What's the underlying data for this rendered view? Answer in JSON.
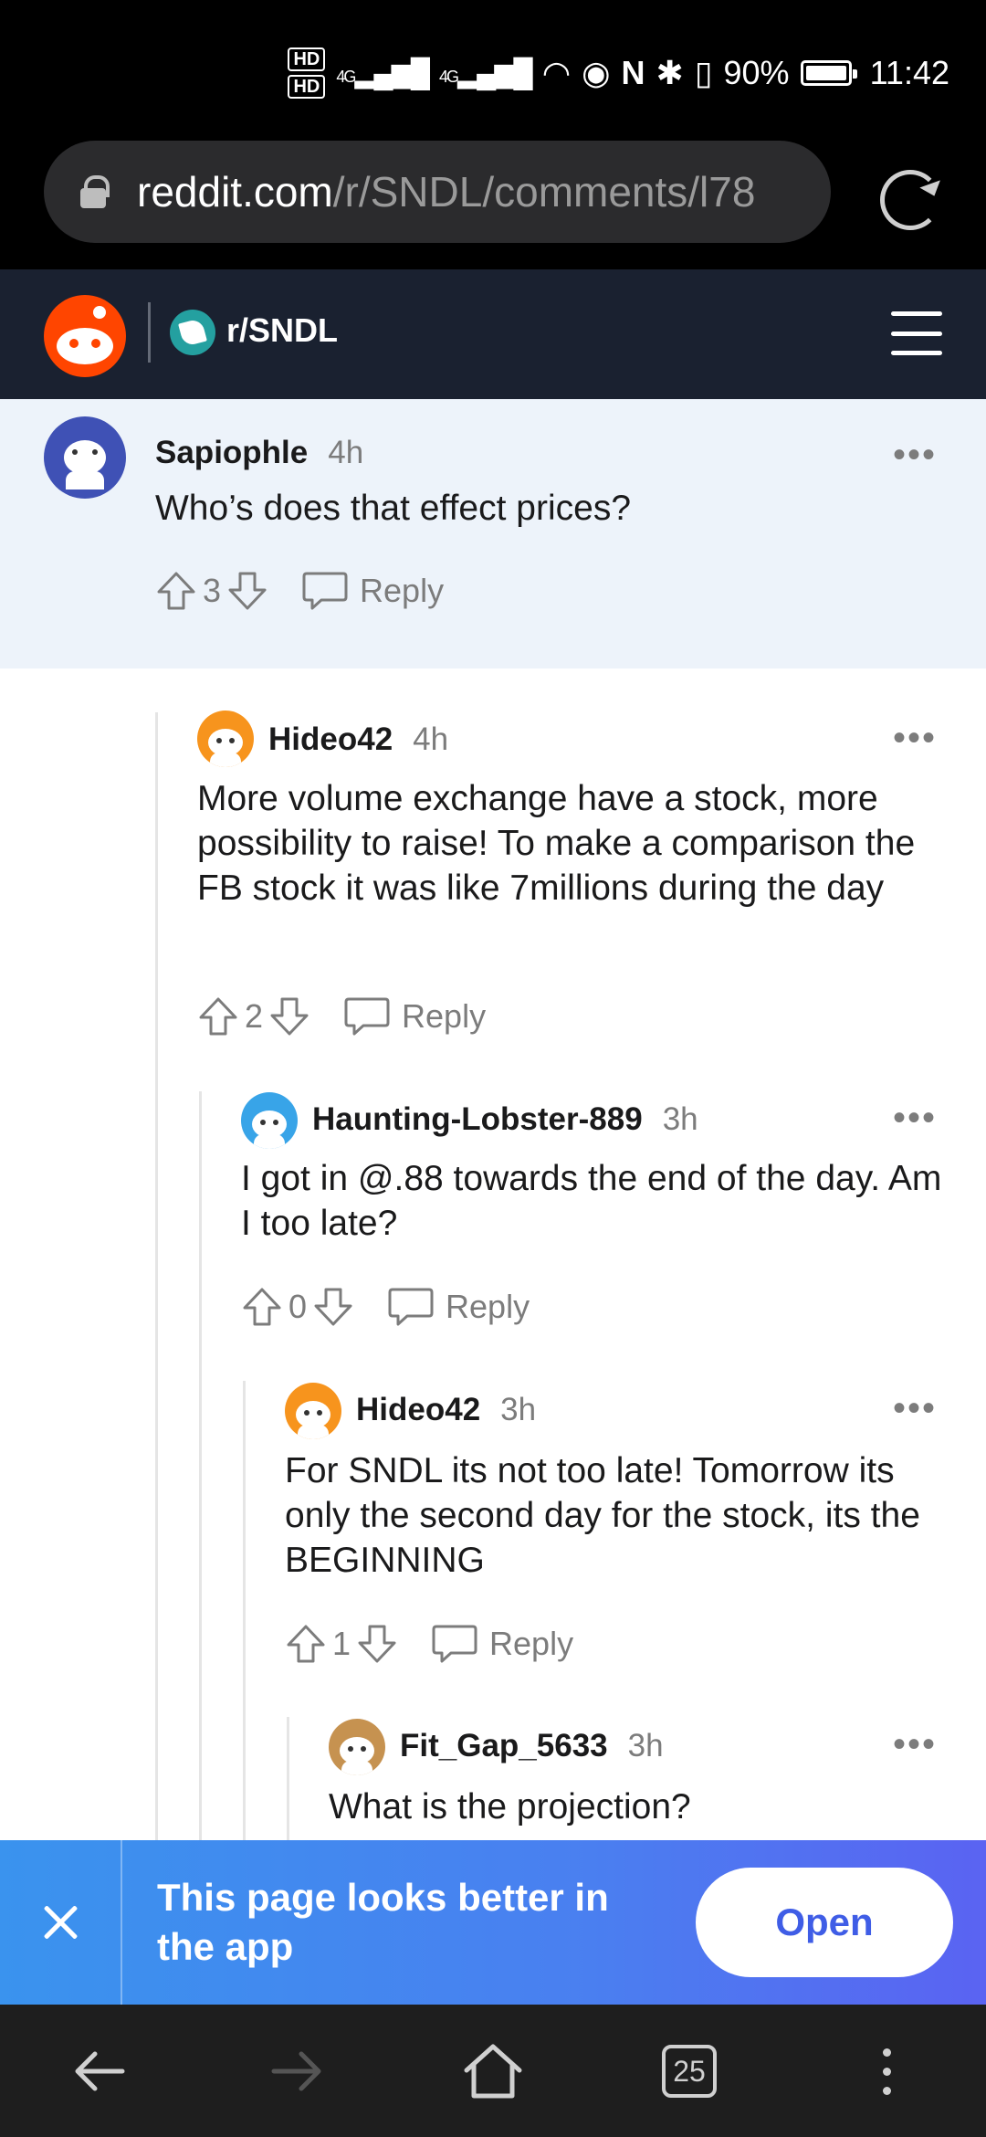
{
  "status_bar": {
    "hd1": "HD",
    "hd2": "HD",
    "network1": "4G",
    "network2": "4G",
    "battery_pct": "90%",
    "time": "11:42"
  },
  "address_bar": {
    "host": "reddit.com",
    "path": "/r/SNDL/comments/l78"
  },
  "header": {
    "subreddit": "r/SNDL"
  },
  "comments": [
    {
      "user": "Sapiophle",
      "time": "4h",
      "text": "Who’s does that effect prices?",
      "votes": "3",
      "reply_label": "Reply"
    },
    {
      "user": "Hideo42",
      "time": "4h",
      "text": "More volume exchange have a stock, more possibility to raise! To make a comparison the FB stock it was like 7millions during the day",
      "votes": "2",
      "reply_label": "Reply"
    },
    {
      "user": "Haunting-Lobster-889",
      "time": "3h",
      "text": "I got in @.88 towards the end of the day. Am I too late?",
      "votes": "0",
      "reply_label": "Reply"
    },
    {
      "user": "Hideo42",
      "time": "3h",
      "text": "For SNDL its not too late! Tomorrow its only the second day for the stock, its the BEGINNING",
      "votes": "1",
      "reply_label": "Reply"
    },
    {
      "user": "Fit_Gap_5633",
      "time": "3h",
      "text": "What is the projection?"
    }
  ],
  "banner": {
    "message": "This page looks better in the app",
    "open_label": "Open"
  },
  "bottom_nav": {
    "tab_count": "25"
  },
  "colors": {
    "reddit_orange": "#ff4500",
    "header_bg": "#1a2130",
    "highlight_bg": "#edf3fa",
    "banner_accent": "#3f5de6"
  }
}
